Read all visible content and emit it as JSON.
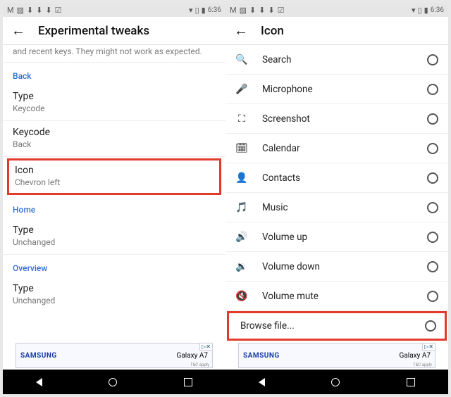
{
  "status": {
    "time": "6:36"
  },
  "left": {
    "title": "Experimental tweaks",
    "trunc": "and recent keys. They might not work as expected.",
    "sections": {
      "back_label": "Back",
      "home_label": "Home",
      "overview_label": "Overview"
    },
    "prefs": {
      "type1_t": "Type",
      "type1_s": "Keycode",
      "key_t": "Keycode",
      "key_s": "Back",
      "icon_t": "Icon",
      "icon_s": "Chevron left",
      "type2_t": "Type",
      "type2_s": "Unchanged",
      "type3_t": "Type",
      "type3_s": "Unchanged"
    }
  },
  "right": {
    "title": "Icon",
    "items": [
      {
        "label": "Search"
      },
      {
        "label": "Microphone"
      },
      {
        "label": "Screenshot"
      },
      {
        "label": "Calendar"
      },
      {
        "label": "Contacts"
      },
      {
        "label": "Music"
      },
      {
        "label": "Volume up"
      },
      {
        "label": "Volume down"
      },
      {
        "label": "Volume mute"
      },
      {
        "label": "Browse file..."
      }
    ]
  },
  "ad": {
    "brand": "SAMSUNG",
    "model": "Galaxy A7",
    "choices": "▷✕",
    "tac": "T&C apply"
  }
}
